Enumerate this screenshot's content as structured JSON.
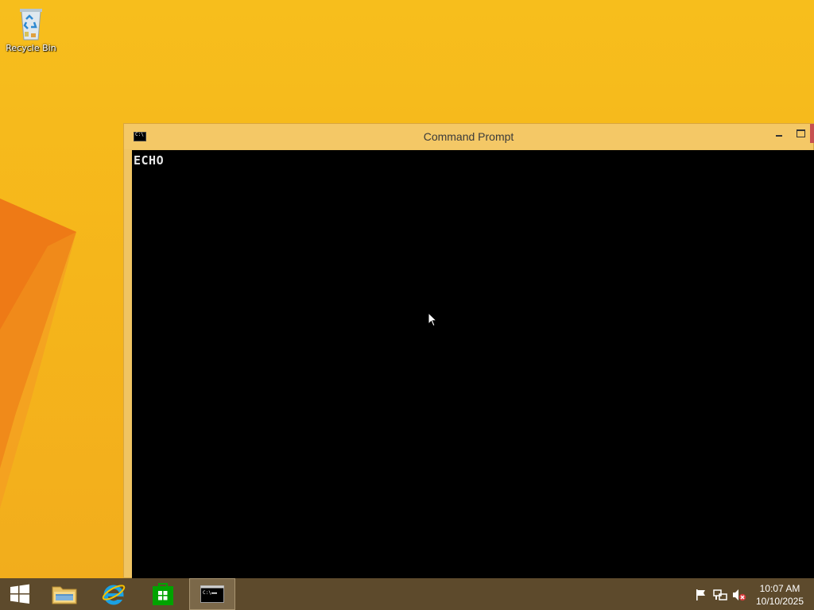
{
  "desktop": {
    "icons": [
      {
        "label": "Recycle Bin",
        "icon": "recycle-bin-icon"
      }
    ],
    "background_color": "#f6b81c"
  },
  "cmd_window": {
    "title": "Command Prompt",
    "console_output": "ECHO",
    "console_background": "#000000",
    "titlebar_color": "#f4c866"
  },
  "taskbar": {
    "pinned": [
      {
        "name": "start",
        "icon": "windows-logo-icon"
      },
      {
        "name": "file-explorer",
        "icon": "folder-icon"
      },
      {
        "name": "internet-explorer",
        "icon": "internet-explorer-icon"
      },
      {
        "name": "store",
        "icon": "store-icon"
      },
      {
        "name": "command-prompt",
        "icon": "cmd-icon",
        "active": true
      }
    ],
    "tray": {
      "icons": [
        "flag-icon",
        "network-icon",
        "volume-muted-icon"
      ],
      "time": "10:07 AM",
      "date": "10/10/2025"
    },
    "color": "#5d4a2c"
  }
}
